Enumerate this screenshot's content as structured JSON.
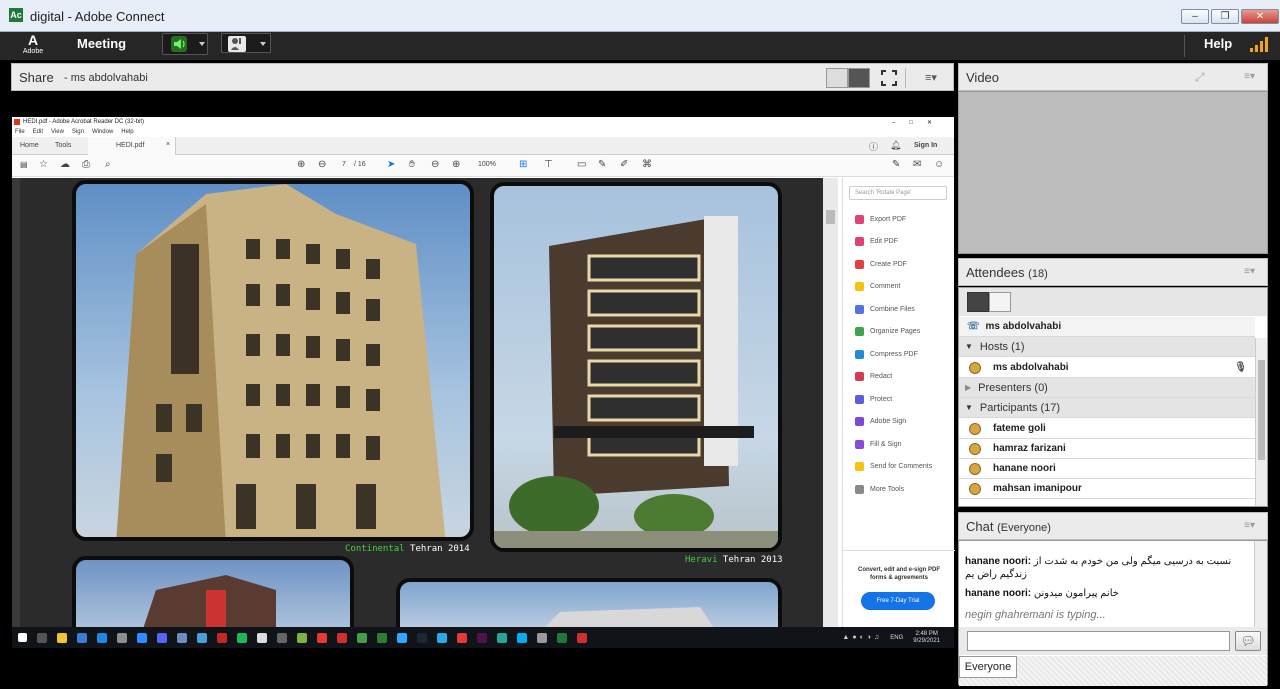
{
  "window": {
    "title": "digital - Adobe Connect",
    "icon_text": "Ac"
  },
  "menubar": {
    "logo_mark": "A",
    "logo_text": "Adobe",
    "meeting": "Meeting",
    "help": "Help"
  },
  "share": {
    "title": "Share",
    "presenter": "ms abdolvahabi"
  },
  "acrobat": {
    "title": "HEDI.pdf - Adobe Acrobat Reader DC (32-bit)",
    "menu": [
      "File",
      "Edit",
      "View",
      "Sign",
      "Window",
      "Help"
    ],
    "tabs": [
      "Home",
      "Tools",
      "HEDI.pdf"
    ],
    "sign_in": "Sign In",
    "page_current": "7",
    "page_total": "/ 16",
    "zoom": "100%",
    "search_placeholder": "Search 'Rotate Page'",
    "tools": [
      "Export PDF",
      "Edit PDF",
      "Create PDF",
      "Comment",
      "Combine Files",
      "Organize Pages",
      "Compress PDF",
      "Redact",
      "Protect",
      "Adobe Sign",
      "Fill & Sign",
      "Send for Comments",
      "More Tools"
    ],
    "promo_text": "Convert, edit and e-sign PDF forms & agreements",
    "promo_button": "Free 7-Day Trial",
    "caption1": {
      "highlight": "Continental",
      "rest": " Tehran 2014"
    },
    "caption2": {
      "highlight": "Heravi",
      "rest": " Tehran 2013"
    }
  },
  "taskbar": {
    "lang": "ENG",
    "time": "2:48 PM",
    "date": "9/29/2021"
  },
  "video": {
    "title": "Video"
  },
  "attendees": {
    "title": "Attendees",
    "count": "(18)",
    "me": "ms abdolvahabi",
    "hosts_label": "Hosts (1)",
    "hosts": [
      "ms abdolvahabi"
    ],
    "presenters_label": "Presenters (0)",
    "participants_label": "Participants (17)",
    "participants": [
      "fateme goli",
      "hamraz farizani",
      "hanane noori",
      "mahsan imanipour"
    ]
  },
  "chat": {
    "title": "Chat",
    "scope": "(Everyone)",
    "messages": [
      {
        "sender": "hanane noori:",
        "text": "نسبت به درسیی میگم ولی من خودم به شدت از زندگیم راض یم"
      },
      {
        "sender": "hanane noori:",
        "text": "خانم پیرامون میدونن"
      }
    ],
    "typing": "negin ghahremani is typing...",
    "recipient": "Everyone"
  },
  "colors": {
    "accent_green": "#3fd13f",
    "signal_orange": "#f0a31b",
    "acrobat_blue": "#1473e6"
  }
}
